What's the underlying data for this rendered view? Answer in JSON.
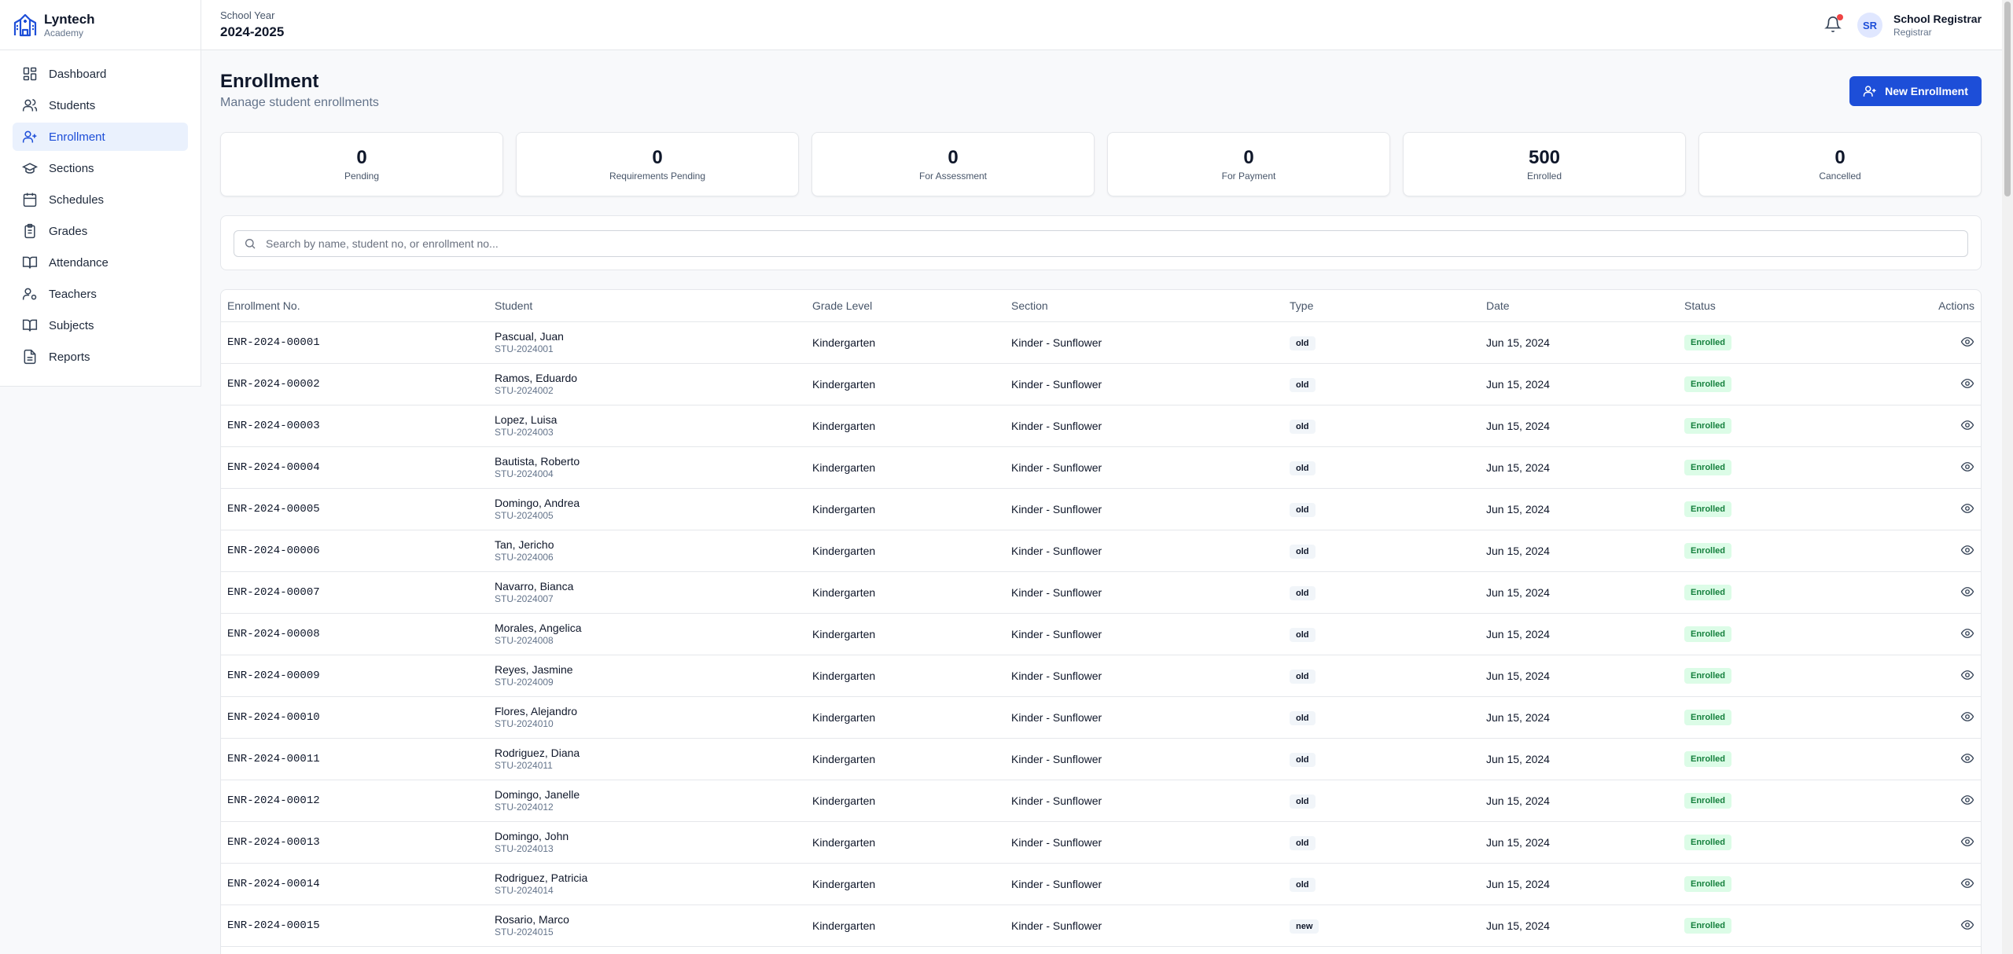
{
  "brand": {
    "name": "Lyntech",
    "subtitle": "Academy"
  },
  "sidebar": {
    "items": [
      {
        "label": "Dashboard",
        "icon": "dashboard-icon"
      },
      {
        "label": "Students",
        "icon": "users-icon"
      },
      {
        "label": "Enrollment",
        "icon": "user-plus-icon",
        "active": true
      },
      {
        "label": "Sections",
        "icon": "graduation-cap-icon"
      },
      {
        "label": "Schedules",
        "icon": "calendar-icon"
      },
      {
        "label": "Grades",
        "icon": "clipboard-icon"
      },
      {
        "label": "Attendance",
        "icon": "book-open-icon"
      },
      {
        "label": "Teachers",
        "icon": "user-cog-icon"
      },
      {
        "label": "Subjects",
        "icon": "book-icon"
      },
      {
        "label": "Reports",
        "icon": "file-text-icon"
      }
    ]
  },
  "header": {
    "school_year_label": "School Year",
    "school_year": "2024-2025",
    "user_initials": "SR",
    "user_name": "School Registrar",
    "user_role": "Registrar"
  },
  "page": {
    "title": "Enrollment",
    "subtitle": "Manage student enrollments",
    "new_button": "New Enrollment"
  },
  "stats": [
    {
      "value": "0",
      "label": "Pending"
    },
    {
      "value": "0",
      "label": "Requirements Pending"
    },
    {
      "value": "0",
      "label": "For Assessment"
    },
    {
      "value": "0",
      "label": "For Payment"
    },
    {
      "value": "500",
      "label": "Enrolled"
    },
    {
      "value": "0",
      "label": "Cancelled"
    }
  ],
  "search": {
    "placeholder": "Search by name, student no, or enrollment no..."
  },
  "table": {
    "columns": [
      "Enrollment No.",
      "Student",
      "Grade Level",
      "Section",
      "Type",
      "Date",
      "Status",
      "Actions"
    ],
    "rows": [
      {
        "enr": "ENR-2024-00001",
        "name": "Pascual, Juan",
        "sid": "STU-2024001",
        "grade": "Kindergarten",
        "section": "Kinder - Sunflower",
        "type": "old",
        "date": "Jun 15, 2024",
        "status": "Enrolled"
      },
      {
        "enr": "ENR-2024-00002",
        "name": "Ramos, Eduardo",
        "sid": "STU-2024002",
        "grade": "Kindergarten",
        "section": "Kinder - Sunflower",
        "type": "old",
        "date": "Jun 15, 2024",
        "status": "Enrolled"
      },
      {
        "enr": "ENR-2024-00003",
        "name": "Lopez, Luisa",
        "sid": "STU-2024003",
        "grade": "Kindergarten",
        "section": "Kinder - Sunflower",
        "type": "old",
        "date": "Jun 15, 2024",
        "status": "Enrolled"
      },
      {
        "enr": "ENR-2024-00004",
        "name": "Bautista, Roberto",
        "sid": "STU-2024004",
        "grade": "Kindergarten",
        "section": "Kinder - Sunflower",
        "type": "old",
        "date": "Jun 15, 2024",
        "status": "Enrolled"
      },
      {
        "enr": "ENR-2024-00005",
        "name": "Domingo, Andrea",
        "sid": "STU-2024005",
        "grade": "Kindergarten",
        "section": "Kinder - Sunflower",
        "type": "old",
        "date": "Jun 15, 2024",
        "status": "Enrolled"
      },
      {
        "enr": "ENR-2024-00006",
        "name": "Tan, Jericho",
        "sid": "STU-2024006",
        "grade": "Kindergarten",
        "section": "Kinder - Sunflower",
        "type": "old",
        "date": "Jun 15, 2024",
        "status": "Enrolled"
      },
      {
        "enr": "ENR-2024-00007",
        "name": "Navarro, Bianca",
        "sid": "STU-2024007",
        "grade": "Kindergarten",
        "section": "Kinder - Sunflower",
        "type": "old",
        "date": "Jun 15, 2024",
        "status": "Enrolled"
      },
      {
        "enr": "ENR-2024-00008",
        "name": "Morales, Angelica",
        "sid": "STU-2024008",
        "grade": "Kindergarten",
        "section": "Kinder - Sunflower",
        "type": "old",
        "date": "Jun 15, 2024",
        "status": "Enrolled"
      },
      {
        "enr": "ENR-2024-00009",
        "name": "Reyes, Jasmine",
        "sid": "STU-2024009",
        "grade": "Kindergarten",
        "section": "Kinder - Sunflower",
        "type": "old",
        "date": "Jun 15, 2024",
        "status": "Enrolled"
      },
      {
        "enr": "ENR-2024-00010",
        "name": "Flores, Alejandro",
        "sid": "STU-2024010",
        "grade": "Kindergarten",
        "section": "Kinder - Sunflower",
        "type": "old",
        "date": "Jun 15, 2024",
        "status": "Enrolled"
      },
      {
        "enr": "ENR-2024-00011",
        "name": "Rodriguez, Diana",
        "sid": "STU-2024011",
        "grade": "Kindergarten",
        "section": "Kinder - Sunflower",
        "type": "old",
        "date": "Jun 15, 2024",
        "status": "Enrolled"
      },
      {
        "enr": "ENR-2024-00012",
        "name": "Domingo, Janelle",
        "sid": "STU-2024012",
        "grade": "Kindergarten",
        "section": "Kinder - Sunflower",
        "type": "old",
        "date": "Jun 15, 2024",
        "status": "Enrolled"
      },
      {
        "enr": "ENR-2024-00013",
        "name": "Domingo, John",
        "sid": "STU-2024013",
        "grade": "Kindergarten",
        "section": "Kinder - Sunflower",
        "type": "old",
        "date": "Jun 15, 2024",
        "status": "Enrolled"
      },
      {
        "enr": "ENR-2024-00014",
        "name": "Rodriguez, Patricia",
        "sid": "STU-2024014",
        "grade": "Kindergarten",
        "section": "Kinder - Sunflower",
        "type": "old",
        "date": "Jun 15, 2024",
        "status": "Enrolled"
      },
      {
        "enr": "ENR-2024-00015",
        "name": "Rosario, Marco",
        "sid": "STU-2024015",
        "grade": "Kindergarten",
        "section": "Kinder - Sunflower",
        "type": "new",
        "date": "Jun 15, 2024",
        "status": "Enrolled"
      }
    ]
  },
  "colors": {
    "accent": "#1d4ed8",
    "enrolled_bg": "#dcfce7",
    "enrolled_text": "#15803d",
    "notification": "#ef4444"
  }
}
